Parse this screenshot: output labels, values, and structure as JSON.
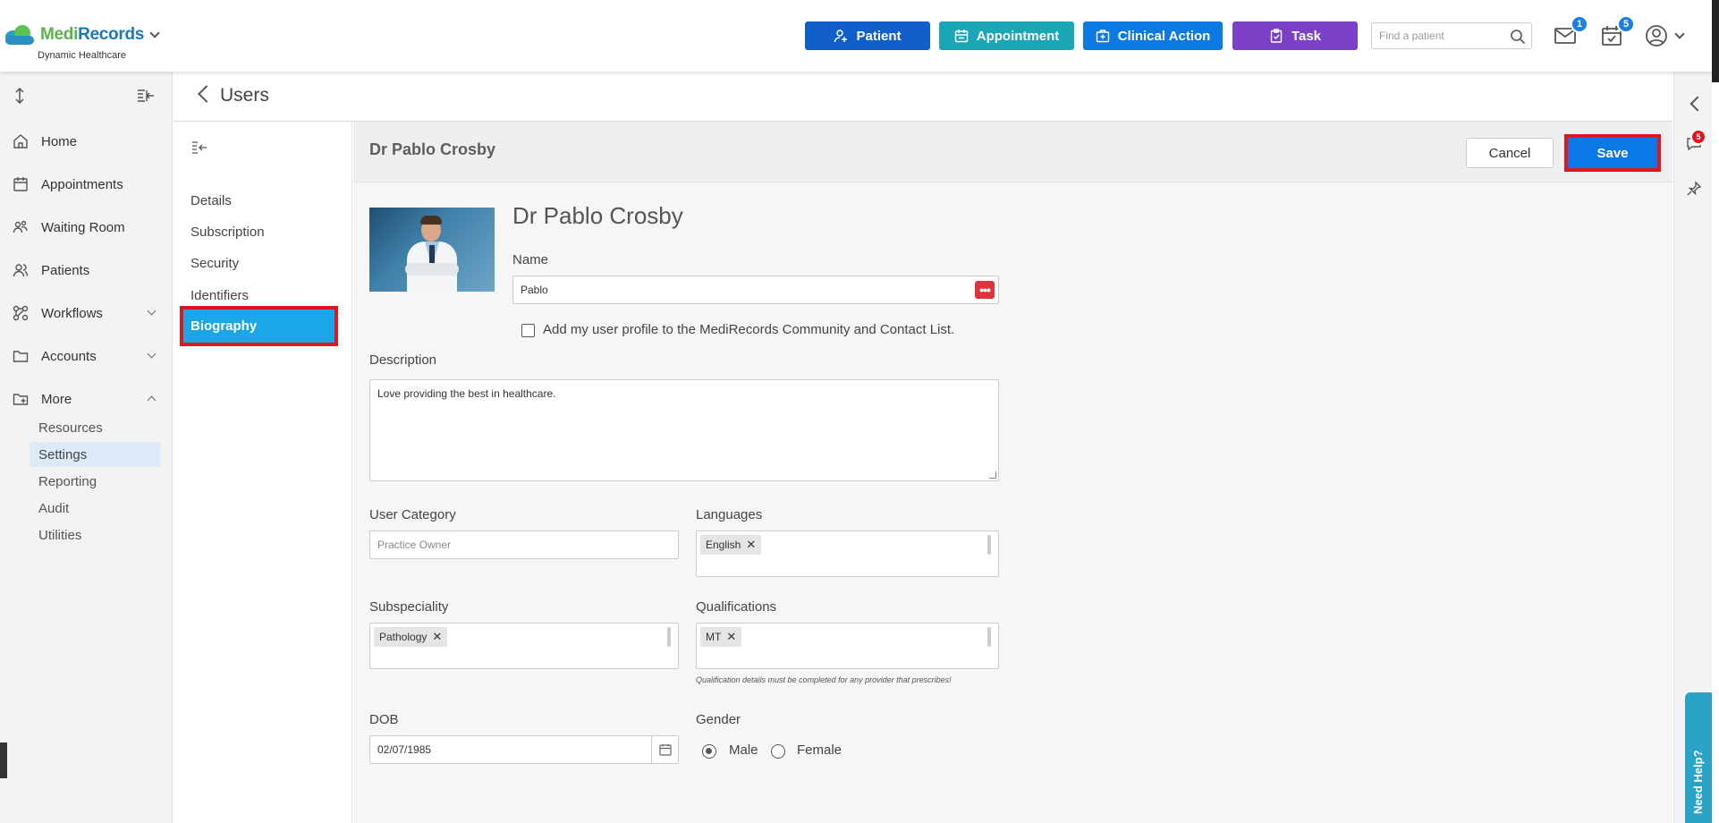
{
  "brand": {
    "name_part1": "Medi",
    "name_part2": "Records",
    "subtitle": "Dynamic Healthcare"
  },
  "header": {
    "buttons": [
      {
        "label": "Patient",
        "icon": "user-plus-icon",
        "color": "#1160c9"
      },
      {
        "label": "Appointment",
        "icon": "calendar-icon",
        "color": "#1ba6b5"
      },
      {
        "label": "Clinical Action",
        "icon": "medical-kit-icon",
        "color": "#0d79e2"
      },
      {
        "label": "Task",
        "icon": "clipboard-icon",
        "color": "#7b3fc8"
      }
    ],
    "search": {
      "placeholder": "Find a patient",
      "value": ""
    },
    "mail_count": "1",
    "tasks_count": "5"
  },
  "sidebar": {
    "items": [
      {
        "label": "Home",
        "icon": "home-icon"
      },
      {
        "label": "Appointments",
        "icon": "calendar-icon"
      },
      {
        "label": "Waiting Room",
        "icon": "people-icon"
      },
      {
        "label": "Patients",
        "icon": "users-icon"
      },
      {
        "label": "Workflows",
        "icon": "workflow-icon"
      },
      {
        "label": "Accounts",
        "icon": "folder-icon"
      },
      {
        "label": "More",
        "icon": "folder-plus-icon"
      }
    ],
    "more_items": [
      {
        "label": "Resources"
      },
      {
        "label": "Settings"
      },
      {
        "label": "Reporting"
      },
      {
        "label": "Audit"
      },
      {
        "label": "Utilities"
      }
    ]
  },
  "page": {
    "title": "Users"
  },
  "subnav": {
    "items": [
      {
        "label": "Details"
      },
      {
        "label": "Subscription"
      },
      {
        "label": "Security"
      },
      {
        "label": "Identifiers"
      },
      {
        "label": "Biography"
      }
    ]
  },
  "main": {
    "header_name": "Dr Pablo Crosby",
    "cancel_label": "Cancel",
    "save_label": "Save",
    "profile_title": "Dr Pablo Crosby",
    "name_label": "Name",
    "name_value": "Pablo",
    "community_checkbox_label": "Add my user profile to the MediRecords Community and Contact List.",
    "description_label": "Description",
    "description_value": "Love providing the best in healthcare.",
    "user_category_label": "User Category",
    "user_category_placeholder": "Practice Owner",
    "languages_label": "Languages",
    "languages": [
      "English"
    ],
    "subspeciality_label": "Subspeciality",
    "subspecialities": [
      "Pathology"
    ],
    "qualifications_label": "Qualifications",
    "qualifications": [
      "MT"
    ],
    "qualifications_note": "Qualification details must be completed for any provider that prescribes!",
    "dob_label": "DOB",
    "dob_value": "02/07/1985",
    "gender_label": "Gender",
    "gender_options": [
      "Male",
      "Female"
    ],
    "gender_selected": "Male"
  },
  "rail": {
    "notification_count": "5",
    "help_label": "Need Help?"
  },
  "colors": {
    "accent": "#0b78e8",
    "highlight_border": "#e0161e",
    "active_subnav": "#1aa7e8"
  }
}
